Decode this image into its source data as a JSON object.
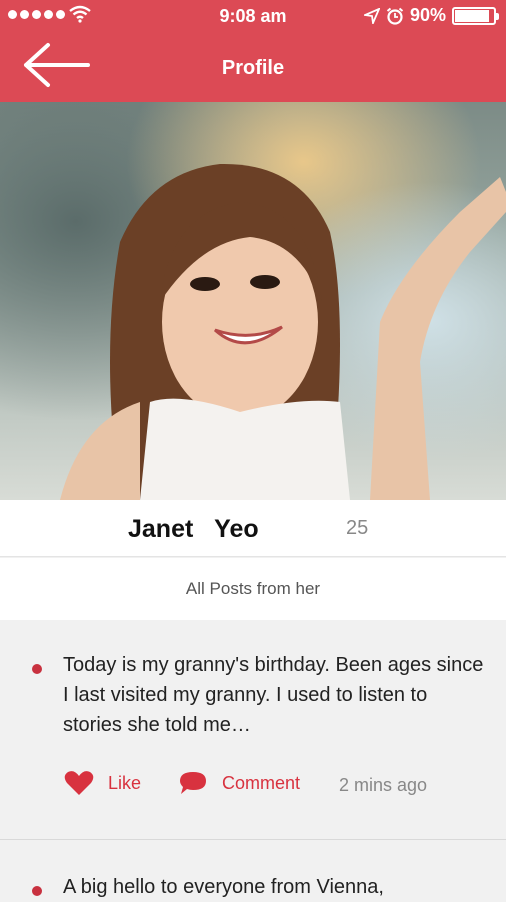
{
  "status_bar": {
    "time": "9:08 am",
    "battery_percent": "90%",
    "battery_level": 0.9
  },
  "header": {
    "title": "Profile",
    "back_icon": "arrow-left-icon"
  },
  "profile": {
    "first_name": "Janet",
    "last_name": "Yeo",
    "age": "25"
  },
  "posts_header": "All Posts from her",
  "posts": [
    {
      "text": "Today is my granny's birthday. Been ages since I last visited my granny. I used to listen to stories she told me…",
      "like_label": "Like",
      "comment_label": "Comment",
      "time_ago": "2 mins ago"
    },
    {
      "text": "A big hello to everyone from Vienna,"
    }
  ],
  "colors": {
    "accent": "#dc4a55",
    "action": "#d8323f"
  }
}
